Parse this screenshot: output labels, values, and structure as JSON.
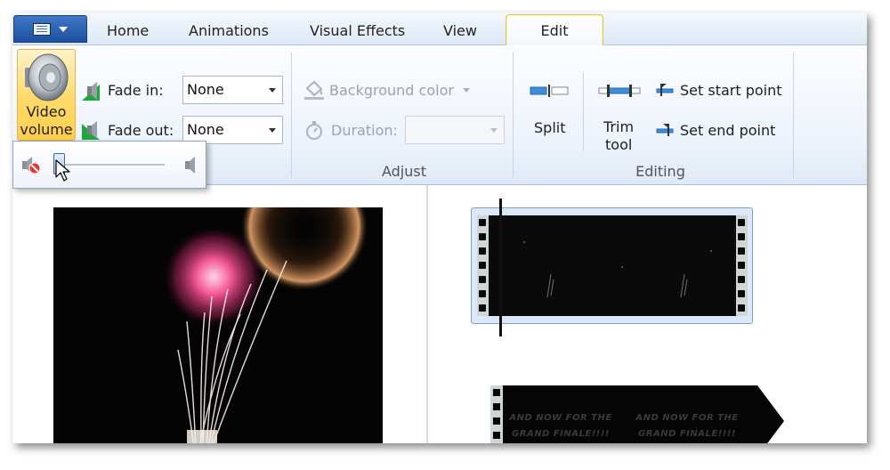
{
  "app": {
    "tabs": [
      "Home",
      "Animations",
      "Visual Effects",
      "View",
      "Edit"
    ],
    "active_tab": "Edit"
  },
  "ribbon": {
    "audio": {
      "video_volume_label_line1": "Video",
      "video_volume_label_line2": "volume",
      "fade_in_label": "Fade in:",
      "fade_in_value": "None",
      "fade_out_label": "Fade out:",
      "fade_out_value": "None"
    },
    "adjust": {
      "background_color_label": "Background color",
      "duration_label": "Duration:",
      "duration_value": "",
      "group_label": "Adjust"
    },
    "editing": {
      "split_label": "Split",
      "trim_label_line1": "Trim",
      "trim_label_line2": "tool",
      "set_start_label": "Set start point",
      "set_end_label": "Set end point",
      "group_label": "Editing"
    }
  },
  "volume_popup": {
    "level": 0.0
  },
  "storyboard": {
    "title_card_text": "AND NOW FOR THE GRAND FINALE!!!!"
  },
  "colors": {
    "accent": "#ffd96a",
    "ribbon_bg": "#edf3fb",
    "app_button": "#2a5fb0"
  }
}
